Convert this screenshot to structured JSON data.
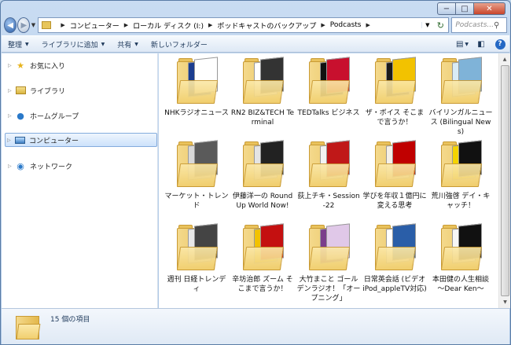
{
  "window": {
    "caption": {
      "minimize": "−",
      "maximize": "□",
      "close": "✕"
    }
  },
  "address_bar": {
    "crumbs": [
      "コンピューター",
      "ローカル ディスク (I:)",
      "ポッドキャストのバックアップ",
      "Podcasts"
    ],
    "search_placeholder": "Podcasts..."
  },
  "toolbar": {
    "organize": "整理",
    "add_to_library": "ライブラリに追加",
    "share": "共有",
    "new_folder": "新しいフォルダー"
  },
  "nav_pane": {
    "items": [
      {
        "label": "お気に入り",
        "icon": "star-icon"
      },
      {
        "label": "ライブラリ",
        "icon": "library-icon"
      },
      {
        "label": "ホームグループ",
        "icon": "homegroup-icon"
      },
      {
        "label": "コンピューター",
        "icon": "computer-icon",
        "selected": true
      },
      {
        "label": "ネットワーク",
        "icon": "network-icon"
      }
    ]
  },
  "folders": [
    {
      "label": "NHKラジオニュース",
      "cover": "#1b3d8f",
      "cover2": "#ffffff"
    },
    {
      "label": "RN2 BIZ&TECH Terminal",
      "cover": "#ffffff",
      "cover2": "#333333"
    },
    {
      "label": "TEDTalks ビジネス",
      "cover": "#111111",
      "cover2": "#c8102e"
    },
    {
      "label": "ザ・ボイス そこまで言うか！",
      "cover": "#1a1a1a",
      "cover2": "#f2c200"
    },
    {
      "label": "バイリンガルニュース (Bilingual News)",
      "cover": "#d9ecf7",
      "cover2": "#7fb3d8"
    },
    {
      "label": "マーケット・トレンド",
      "cover": "#d8d8d8",
      "cover2": "#5a5a5a"
    },
    {
      "label": "伊藤洋一の Round Up World Now!",
      "cover": "#e4e4e4",
      "cover2": "#222222"
    },
    {
      "label": "荻上チキ・Session-22",
      "cover": "#f2f2f2",
      "cover2": "#c01818"
    },
    {
      "label": "学びを年収１億円に変える思考",
      "cover": "#f5f0e8",
      "cover2": "#c00000"
    },
    {
      "label": "荒川強啓 デイ・キャッチ！",
      "cover": "#f4d400",
      "cover2": "#111111"
    },
    {
      "label": "週刊 日経トレンディ",
      "cover": "#e8e8e8",
      "cover2": "#444444"
    },
    {
      "label": "辛坊治郎 ズーム そこまで言うか！",
      "cover": "#f2c200",
      "cover2": "#c41010"
    },
    {
      "label": "大竹まこと ゴールデンラジオ！「オープニング」",
      "cover": "#7a3d8c",
      "cover2": "#e0c8e8"
    },
    {
      "label": "日常英会話 (ビデオ iPod_appleTV対応)",
      "cover": "#ffffff",
      "cover2": "#2a5ea8"
    },
    {
      "label": "本田健の人生相談 ～Dear Ken～",
      "cover": "#f6f6f6",
      "cover2": "#111111"
    }
  ],
  "details": {
    "count_text": "15 個の項目"
  }
}
